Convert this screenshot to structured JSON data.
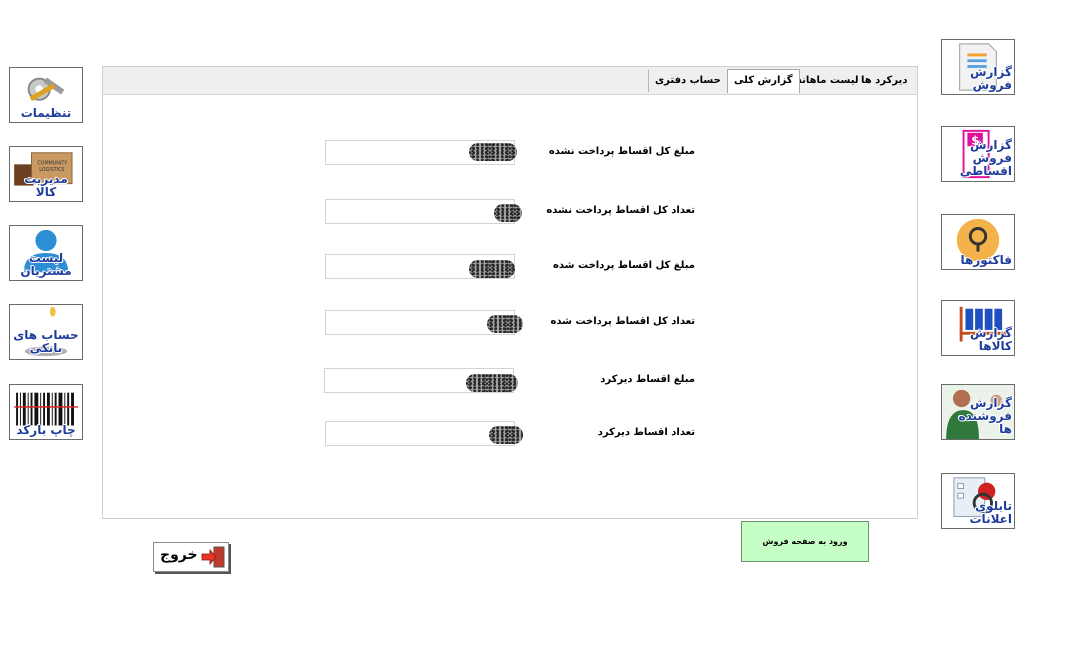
{
  "left_menu": [
    {
      "label": "تنظیمات",
      "icon": "tools-icon"
    },
    {
      "label": "مدیریت کالا",
      "icon": "boxes-icon"
    },
    {
      "label": "لیست مشتریان",
      "icon": "user-icon"
    },
    {
      "label": "حساب های بانکی",
      "icon": "bank-icon"
    },
    {
      "label": "چاپ بارکد",
      "icon": "barcode-icon"
    }
  ],
  "right_menu": [
    {
      "label": "گزارش فروش",
      "icon": "sales-report-icon"
    },
    {
      "label": "گزارش فروش اقساطی",
      "icon": "dollar-report-icon"
    },
    {
      "label": "فاکتورها",
      "icon": "invoice-search-icon"
    },
    {
      "label": "گزارش کالاها",
      "icon": "products-chart-icon"
    },
    {
      "label": "گزارش فروشنده ها",
      "icon": "sellers-icon"
    },
    {
      "label": "تابلوی اعلانات",
      "icon": "notice-board-icon"
    }
  ],
  "tabs": [
    {
      "label": "دیرکرد ها",
      "active": false
    },
    {
      "label": "لیست ماهانه",
      "active": false
    },
    {
      "label": "گزارش کلی",
      "active": true
    },
    {
      "label": "حساب دفتری",
      "active": false
    }
  ],
  "fields": [
    {
      "label": "مبلغ کل اقساط پرداخت نشده",
      "value": ""
    },
    {
      "label": "تعداد کل اقساط پرداخت نشده",
      "value": ""
    },
    {
      "label": "مبلغ کل اقساط پرداخت شده",
      "value": ""
    },
    {
      "label": "تعداد کل اقساط پرداخت شده",
      "value": ""
    },
    {
      "label": "مبلغ اقساط دیرکرد",
      "value": ""
    },
    {
      "label": "تعداد اقساط دیرکرد",
      "value": ""
    }
  ],
  "enter_sales_button": "ورود به صفحه فروش",
  "exit_button": "خروج",
  "colors": {
    "enter_button_bg": "#c6ffc6",
    "label_blue": "#1f3d9c"
  }
}
